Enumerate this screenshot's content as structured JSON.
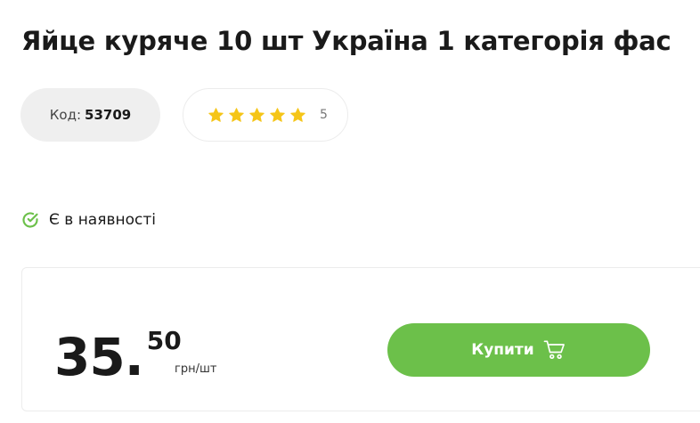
{
  "product": {
    "title": "Яйце куряче 10 шт Україна 1 категорія фас",
    "code_label": "Код:",
    "code_value": "53709"
  },
  "rating": {
    "stars_filled": 5,
    "stars_total": 5,
    "count": "5",
    "star_color": "#f5c518"
  },
  "availability": {
    "text": "Є в наявності",
    "icon": "check-circle-icon",
    "color": "#6cc04a"
  },
  "price": {
    "integer": "35.",
    "fraction": "50",
    "unit": "грн/шт"
  },
  "buy": {
    "label": "Купити",
    "icon": "cart-icon",
    "color": "#6cc04a"
  }
}
